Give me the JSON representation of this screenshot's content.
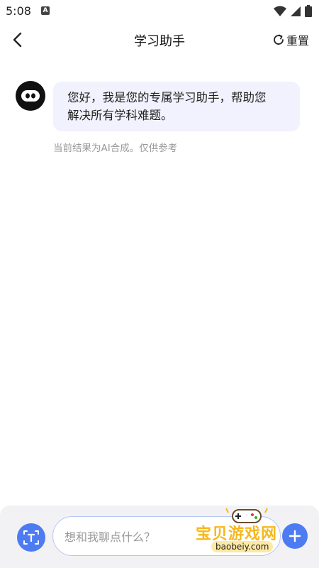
{
  "status_bar": {
    "time": "5:08",
    "notification_letter": "A",
    "icons": [
      "wifi-icon",
      "cell-signal-icon",
      "battery-icon"
    ]
  },
  "app_bar": {
    "back_icon": "chevron-left-icon",
    "title": "学习助手",
    "reset_label": "重置",
    "reset_icon": "refresh-icon"
  },
  "chat": {
    "assistant_avatar_icon": "robot-face-icon",
    "message_line1": "您好，我是您的专属学习助手，帮助您",
    "message_line2": "解决所有学科难题。",
    "disclaimer": "当前结果为AI合成。仅供参考"
  },
  "composer": {
    "text_mode_icon": "text-scan-icon",
    "placeholder": "想和我聊点什么？",
    "send_icon": "plus-icon"
  },
  "watermark": {
    "title": "宝贝游戏网",
    "url": "baobeiy.com"
  },
  "colors": {
    "accent": "#4d7cf2",
    "bubble_bg": "#f1f2fd",
    "input_border": "#b6c6f4",
    "panel_bg": "#f2f2f5"
  }
}
